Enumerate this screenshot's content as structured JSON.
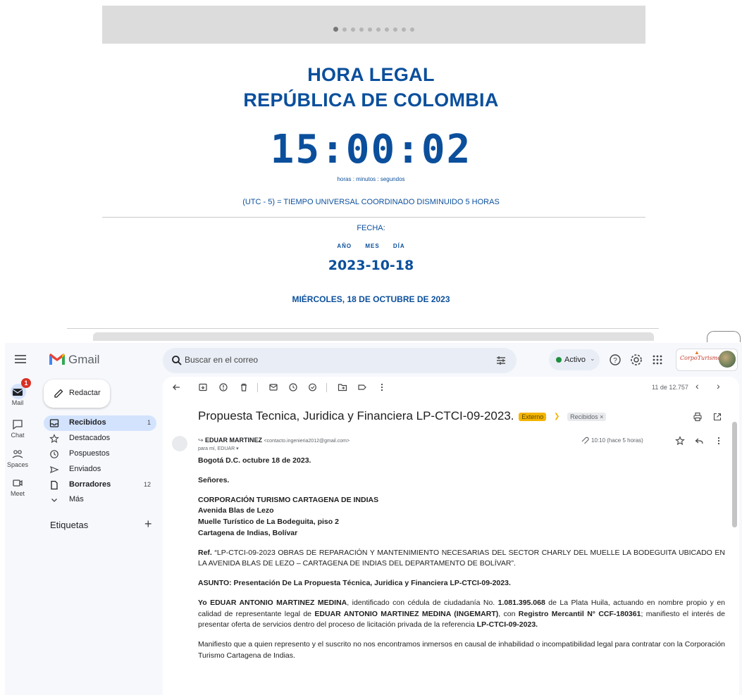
{
  "clock_page": {
    "carousel": {
      "dot_count": 10,
      "active_index": 0
    },
    "title_line1": "HORA LEGAL",
    "title_line2": "REPÚBLICA DE COLOMBIA",
    "time": "15:00:02",
    "time_units": "horas  :  minutos  :  segundos",
    "utc_note": "(UTC - 5) = TIEMPO UNIVERSAL COORDINADO DISMINUIDO 5 HORAS",
    "fecha_label": "FECHA:",
    "fecha_cols": [
      "AÑO",
      "MES",
      "DÍA"
    ],
    "date": "2023-10-18",
    "weekday": "MIÉRCOLES, 18 DE OCTUBRE DE 2023",
    "accent_color": "#0b4f9c"
  },
  "gmail": {
    "app_name": "Gmail",
    "search_placeholder": "Buscar en el correo",
    "status": "Activo",
    "account_brand": "CorpoTurismo",
    "rail": {
      "mail": "Mail",
      "mail_badge": "1",
      "chat": "Chat",
      "spaces": "Spaces",
      "meet": "Meet"
    },
    "compose": "Redactar",
    "nav": [
      {
        "label": "Recibidos",
        "count": "1",
        "icon": "inbox-icon"
      },
      {
        "label": "Destacados",
        "count": "",
        "icon": "star-icon"
      },
      {
        "label": "Pospuestos",
        "count": "",
        "icon": "clock-icon"
      },
      {
        "label": "Enviados",
        "count": "",
        "icon": "send-icon"
      },
      {
        "label": "Borradores",
        "count": "12",
        "icon": "draft-icon"
      },
      {
        "label": "Más",
        "count": "",
        "icon": "chevron-down-icon"
      }
    ],
    "labels_heading": "Etiquetas",
    "pager": "11 de 12.757",
    "message": {
      "subject": "Propuesta Tecnica, Juridica y Financiera LP-CTCI-09-2023.",
      "tag_external": "Externo",
      "tag_inbox": "Recibidos ×",
      "sender_name": "EDUAR MARTINEZ",
      "sender_email": "<contacto.ingenieria2012@gmail.com>",
      "recipient": "para mí, EDUAR",
      "time": "10:10 (hace 5 horas)",
      "body": {
        "line_date": "Bogotá D.C.  octubre 18 de 2023.",
        "salutation": "Señores.",
        "addr1": "CORPORACIÓN TURISMO CARTAGENA DE INDIAS",
        "addr2": "Avenida Blas de Lezo",
        "addr3": "Muelle Turístico de La Bodeguita, piso 2",
        "addr4": "Cartagena de Indias, Bolívar",
        "ref_label": "Ref.",
        "ref_text": " “LP-CTCI-09-2023 OBRAS DE REPARACIÓN Y MANTENIMIENTO NECESARIAS DEL SECTOR CHARLY DEL MUELLE LA BODEGUITA UBICADO EN LA AVENIDA BLAS DE LEZO – CARTAGENA DE INDIAS DEL DEPARTAMENTO DE BOLÍVAR”.",
        "asunto": "ASUNTO: Presentación De La Propuesta Técnica, Juridica y Financiera LP-CTCI-09-2023.",
        "p1_a": "Yo EDUAR ANTONIO MARTINEZ MEDINA",
        "p1_b": ", identificado con cédula de ciudadanía No. ",
        "p1_c": "1.081.395.068",
        "p1_d": " de La Plata Huila, actuando en nombre propio y en calidad de representante legal de ",
        "p1_e": "EDUAR ANTONIO MARTINEZ MEDINA (INGEMART)",
        "p1_f": ", con ",
        "p1_g": "Registro Mercantil N° CCF-180361",
        "p1_h": "; manifiesto el interés de presentar oferta de servicios dentro del proceso de licitación privada de la referencia ",
        "p1_i": "LP-CTCI-09-2023.",
        "p2": "Manifiesto que a quien represento y el suscrito no nos encontramos inmersos en causal de inhabilidad o incompatibilidad legal para contratar con la Corporación Turismo Cartagena de Indias."
      }
    }
  }
}
